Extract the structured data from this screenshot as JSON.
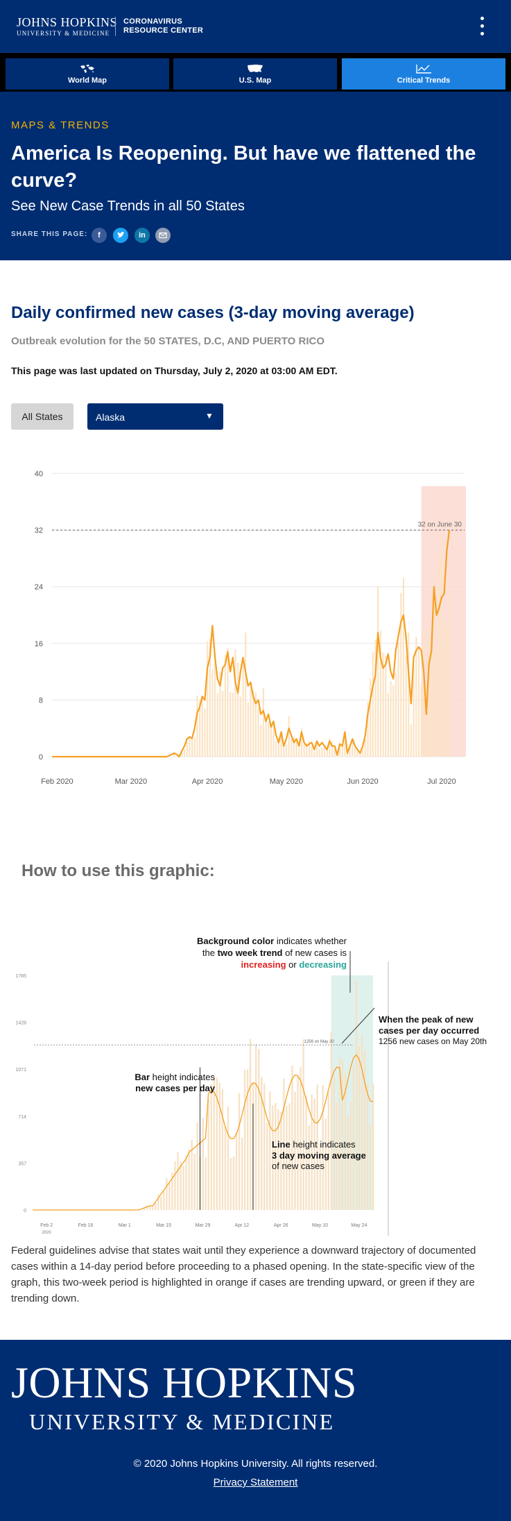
{
  "header": {
    "logo_line1": "JOHNS HOPKINS",
    "logo_line2": "UNIVERSITY & MEDICINE",
    "center_line1": "CORONAVIRUS",
    "center_line2": "RESOURCE CENTER",
    "menu_icon": "kebab-icon"
  },
  "nav": {
    "items": [
      {
        "label": "World Map",
        "icon": "world-map-icon"
      },
      {
        "label": "U.S. Map",
        "icon": "us-map-icon"
      },
      {
        "label": "Critical Trends",
        "icon": "trend-chart-icon",
        "active": true
      }
    ]
  },
  "hero": {
    "eyebrow": "MAPS & TRENDS",
    "title": "America Is Reopening. But have we flattened the curve?",
    "subtitle": "See New Case Trends in all 50 States",
    "share_label": "SHARE THIS PAGE:",
    "share_icons": [
      "facebook-icon",
      "twitter-icon",
      "linkedin-icon",
      "email-icon"
    ]
  },
  "main": {
    "title": "Daily confirmed new cases (3-day moving average)",
    "subtitle": "Outbreak evolution for the 50 STATES, D.C, AND PUERTO RICO",
    "updated": "This page was last updated on Thursday, July 2, 2020 at 03:00 AM EDT.",
    "all_states_label": "All States",
    "state_selected": "Alaska",
    "caret": "▼"
  },
  "colors": {
    "navy": "#002d72",
    "accent_blue": "#1c80e0",
    "gold": "#f0b400",
    "line_orange": "#f5a023",
    "bar_cream": "#fbe3c4",
    "trend_up_band": "#fbd9d0",
    "trend_down_band": "#dcefeb"
  },
  "chart_data": [
    {
      "type": "line",
      "title": "",
      "y_ticks": [
        "0",
        "8",
        "16",
        "24",
        "32",
        "40"
      ],
      "x_ticks": [
        "Feb 2020",
        "Mar 2020",
        "Apr 2020",
        "May 2020",
        "Jun 2020",
        "Jul 2020"
      ],
      "ylim": [
        0,
        40
      ],
      "grid": true,
      "annotation": "32 on June 30",
      "peak_value": 32,
      "highlight": "two-week trend band (increasing)",
      "series": [
        {
          "kind": "line",
          "x_day": [
            0,
            5,
            10,
            15,
            20,
            25,
            30,
            35,
            40,
            45,
            47,
            48,
            49,
            50,
            51,
            52,
            53,
            54,
            55,
            56,
            57,
            58,
            59,
            60,
            61,
            62,
            63,
            64,
            65,
            66,
            67,
            68,
            69,
            70,
            71,
            72,
            73,
            74,
            75,
            76,
            77,
            78,
            79,
            80,
            81,
            82,
            83,
            84,
            85,
            86,
            87,
            88,
            89,
            90,
            91,
            92,
            93,
            94,
            95,
            96,
            97,
            98,
            99,
            100,
            101,
            102,
            103,
            104,
            105,
            106,
            107,
            108,
            109,
            110,
            111,
            112,
            113,
            114,
            115,
            116,
            117,
            118,
            119,
            120,
            121,
            122,
            123,
            124,
            125,
            126,
            127,
            128,
            129,
            130,
            131,
            132,
            133,
            134,
            135,
            136,
            137,
            138,
            139,
            140,
            141,
            142,
            143,
            144,
            145,
            146,
            147,
            148,
            149,
            150,
            151,
            152,
            153,
            154,
            155,
            156,
            157,
            158,
            159,
            160,
            161,
            162
          ],
          "values": [
            0,
            0,
            0,
            0,
            0,
            0,
            0,
            0,
            0,
            0,
            0.3,
            0.5,
            0.3,
            0.0,
            0.8,
            1.5,
            2.5,
            2.8,
            2.6,
            4.0,
            6.2,
            7.0,
            8.5,
            8.0,
            12.5,
            14.0,
            18.5,
            14.0,
            11.0,
            10.0,
            12.5,
            13.0,
            14.8,
            12.0,
            14.0,
            10.5,
            9.0,
            12.0,
            14.0,
            12.0,
            10.0,
            10.5,
            8.5,
            7.5,
            8.0,
            6.0,
            6.5,
            5.0,
            6.0,
            4.2,
            5.0,
            3.0,
            2.0,
            3.5,
            1.5,
            2.5,
            4.0,
            3.0,
            2.0,
            2.5,
            1.5,
            3.5,
            2.0,
            1.5,
            1.8,
            2.0,
            1.0,
            2.2,
            1.5,
            2.0,
            1.5,
            1.0,
            2.2,
            1.5,
            1.5,
            0.2,
            1.8,
            1.5,
            3.5,
            0.5,
            1.5,
            2.5,
            1.5,
            1.0,
            0.5,
            1.5,
            3.0,
            6.0,
            8.0,
            10.0,
            11.5,
            17.5,
            14.0,
            12.5,
            13.0,
            14.5,
            12.0,
            11.0,
            15.0,
            17.0,
            19.0,
            20.0,
            17.0,
            12.0,
            7.5,
            14.0,
            15.0,
            15.5,
            15.0,
            12.0,
            6.0,
            13.0,
            15.0,
            24.0,
            20.0,
            21.0,
            22.5,
            23.0,
            29.0,
            32.0
          ]
        }
      ]
    },
    {
      "type": "line",
      "title": "",
      "y_ticks": [
        "0",
        "357",
        "714",
        "1071",
        "1428",
        "1785"
      ],
      "x_ticks": [
        "Feb 2",
        "Feb 16",
        "Mar 1",
        "Mar 15",
        "Mar 29",
        "Apr 12",
        "Apr 26",
        "May 10",
        "May 24"
      ],
      "x_tick_sub": "2020",
      "ylim": [
        0,
        1785
      ],
      "peak_label": "1256 on May 20",
      "annotations": {
        "background_pre": "Background color",
        "background_mid": " indicates whether the ",
        "background_bold": "two week trend",
        "background_post": " of new cases is",
        "increasing": "increasing",
        "or": " or ",
        "decreasing": "decreasing",
        "peak_title": "When the peak of new cases per day occurred",
        "peak_detail": "1256 new cases on May 20th",
        "bar_bold": "Bar",
        "bar_rest": " height indicates",
        "bar_line2": "new cases per day",
        "line_bold": "Line",
        "line_rest": " height indicates",
        "line_line2": "3 day moving average",
        "line_line3": "of new cases"
      }
    }
  ],
  "guidelines": "Federal guidelines advise that states wait until they experience a downward trajectory of documented cases within a 14-day period before proceeding to a phased opening. In the state-specific view of the graph, this two-week period is highlighted in orange if cases are trending upward, or green if they are trending down.",
  "how_title": "How to use this graphic:",
  "footer": {
    "logo_line1": "JOHNS HOPKINS",
    "logo_line2": "UNIVERSITY & MEDICINE",
    "copyright": "© 2020 Johns Hopkins University. All rights reserved.",
    "privacy": "Privacy Statement"
  }
}
